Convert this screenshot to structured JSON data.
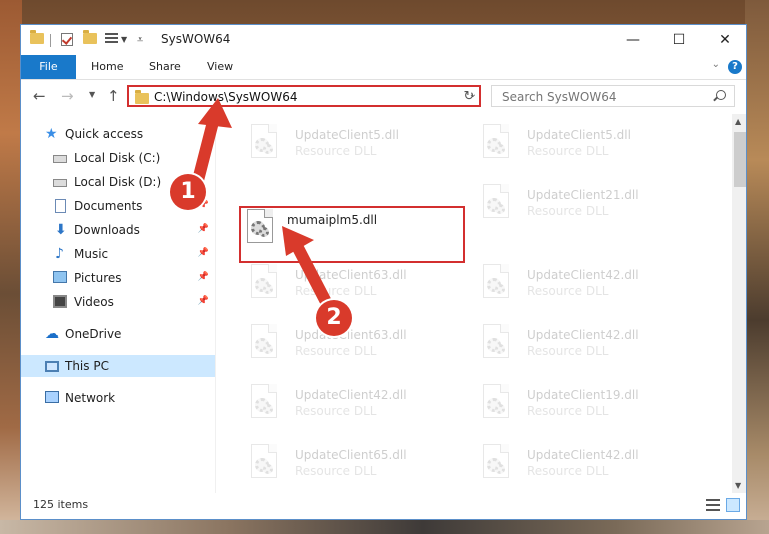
{
  "window": {
    "title": "SysWOW64",
    "controls": {
      "minimize": "—",
      "maximize": "☐",
      "close": "✕"
    }
  },
  "ribbon": {
    "tabs": [
      {
        "label": "File"
      },
      {
        "label": "Home"
      },
      {
        "label": "Share"
      },
      {
        "label": "View"
      }
    ],
    "help": "?"
  },
  "address": {
    "path": "C:\\Windows\\SysWOW64",
    "search_placeholder": "Search SysWOW64"
  },
  "sidebar": {
    "items": [
      {
        "label": "Quick access",
        "icon": "star-icon",
        "pinned": false
      },
      {
        "label": "Local Disk (C:)",
        "icon": "drive-icon",
        "pinned": false
      },
      {
        "label": "Local Disk (D:)",
        "icon": "drive-icon",
        "pinned": false
      },
      {
        "label": "Documents",
        "icon": "documents-icon",
        "pinned": true
      },
      {
        "label": "Downloads",
        "icon": "download-icon",
        "pinned": true
      },
      {
        "label": "Music",
        "icon": "music-icon",
        "pinned": true
      },
      {
        "label": "Pictures",
        "icon": "pictures-icon",
        "pinned": true
      },
      {
        "label": "Videos",
        "icon": "videos-icon",
        "pinned": true
      },
      {
        "label": "OneDrive",
        "icon": "onedrive-icon",
        "pinned": false
      },
      {
        "label": "This PC",
        "icon": "computer-icon",
        "pinned": false,
        "selected": true
      },
      {
        "label": "Network",
        "icon": "network-icon",
        "pinned": false
      }
    ]
  },
  "files": {
    "items": [
      {
        "name": "UpdateClient5.dll",
        "type": "Resource DLL",
        "faded": true
      },
      {
        "name": "UpdateClient5.dll",
        "type": "Resource DLL",
        "faded": true
      },
      {
        "name": "mumaiplm5.dll",
        "type": "",
        "faded": false,
        "highlighted": true
      },
      {
        "name": "UpdateClient21.dll",
        "type": "Resource DLL",
        "faded": true
      },
      {
        "name": "UpdateClient63.dll",
        "type": "Resource DLL",
        "faded": true
      },
      {
        "name": "UpdateClient42.dll",
        "type": "Resource DLL",
        "faded": true
      },
      {
        "name": "UpdateClient63.dll",
        "type": "Resource DLL",
        "faded": true
      },
      {
        "name": "UpdateClient42.dll",
        "type": "Resource DLL",
        "faded": true
      },
      {
        "name": "UpdateClient42.dll",
        "type": "Resource DLL",
        "faded": true
      },
      {
        "name": "UpdateClient19.dll",
        "type": "Resource DLL",
        "faded": true
      },
      {
        "name": "UpdateClient65.dll",
        "type": "Resource DLL",
        "faded": true
      },
      {
        "name": "UpdateClient42.dll",
        "type": "Resource DLL",
        "faded": true
      }
    ]
  },
  "status": {
    "item_count": "125 items"
  },
  "annotations": {
    "step1": "1",
    "step2": "2"
  },
  "colors": {
    "accent": "#1979ca",
    "highlight": "#d32f2f",
    "badge": "#d93a2b",
    "selection": "#cce8ff"
  }
}
